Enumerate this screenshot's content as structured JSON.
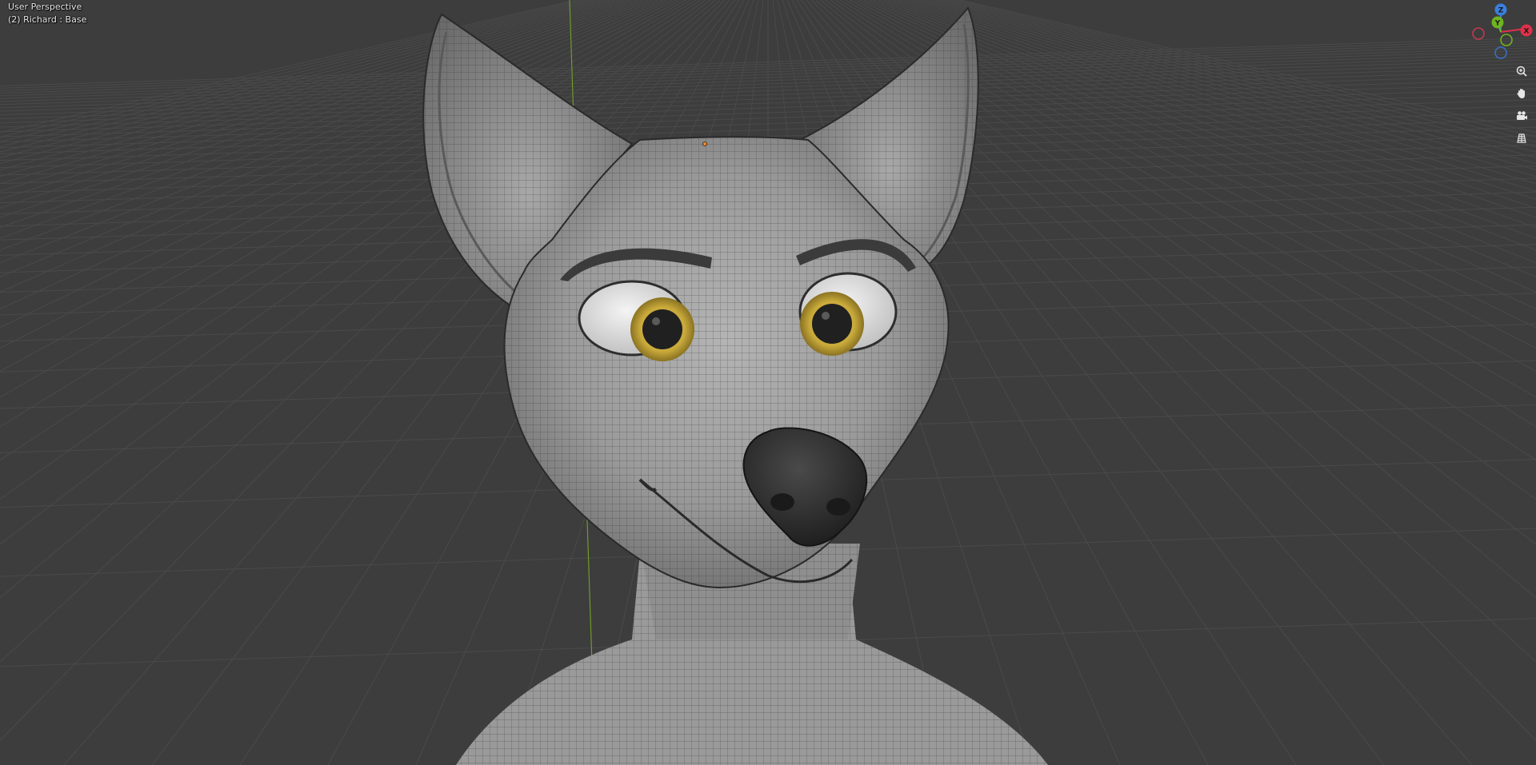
{
  "viewport": {
    "view_name": "User Perspective",
    "object_info": "(2) Richard : Base"
  },
  "gizmo": {
    "x_label": "X",
    "y_label": "Y",
    "z_label": "Z",
    "x_color": "#e0314a",
    "y_color": "#6fb420",
    "z_color": "#3a7fe0"
  },
  "nav_buttons": [
    {
      "name": "zoom",
      "icon": "zoom-icon"
    },
    {
      "name": "pan",
      "icon": "hand-icon"
    },
    {
      "name": "camera",
      "icon": "camera-icon"
    },
    {
      "name": "ortho",
      "icon": "grid-icon"
    }
  ],
  "colors": {
    "background": "#3d3d3d",
    "grid_line": "#4a4a4a",
    "y_axis_line": "#6f9a2a",
    "mesh_base": "#9a9a9a",
    "iris": "#c8a93a"
  }
}
